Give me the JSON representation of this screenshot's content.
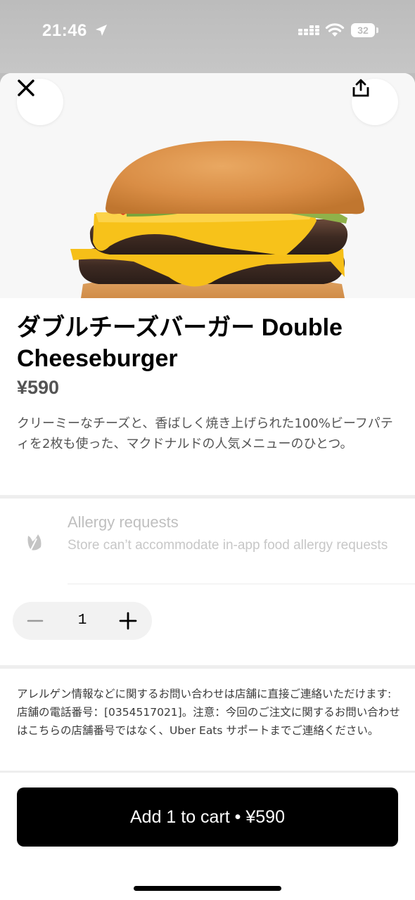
{
  "status_bar": {
    "time": "21:46",
    "battery": "32",
    "icons": [
      "location-arrow-icon",
      "cellular-signal-icon",
      "wifi-icon",
      "battery-icon"
    ]
  },
  "header": {
    "close_icon": "close-icon",
    "share_icon": "share-icon"
  },
  "item": {
    "title": "ダブルチーズバーガー Double Cheeseburger",
    "price": "¥590",
    "description": "クリーミーなチーズと、香ばしく焼き上げられた100%ビーフパティを2枚も使った、マクドナルドの人気メニューのひとつ。"
  },
  "allergy": {
    "title": "Allergy requests",
    "subtitle": "Store can’t accommodate in-app food allergy requests",
    "icon": "allergy-leaf-icon"
  },
  "quantity": {
    "value": "1",
    "minus_icon": "minus-icon",
    "plus_icon": "plus-icon"
  },
  "notice": "アレルゲン情報などに関するお問い合わせは店舗に直接ご連絡いただけます: 店舗の電話番号：[0354517021]。注意：今回のご注文に関するお問い合わせはこちらの店舗番号ではなく、Uber Eats サポートまでご連絡ください。",
  "cart_button": {
    "label": "Add 1 to cart • ¥590"
  },
  "colors": {
    "primary": "#000000",
    "muted_text": "#545454",
    "disabled_text": "#bfbfbf",
    "cheese": "#f7c21a"
  }
}
